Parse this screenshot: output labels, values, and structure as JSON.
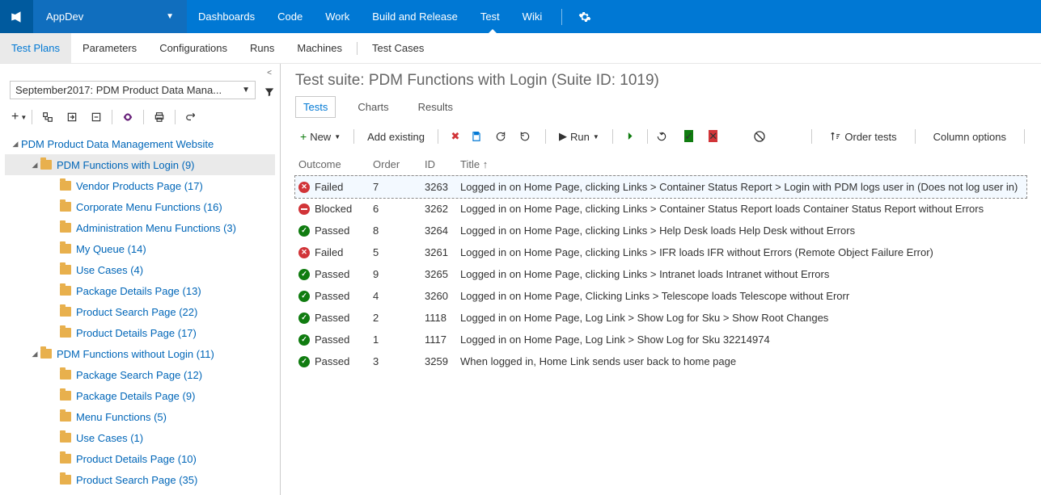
{
  "topnav": {
    "project": "AppDev",
    "tabs": [
      "Dashboards",
      "Code",
      "Work",
      "Build and Release",
      "Test",
      "Wiki"
    ],
    "active_tab": 4
  },
  "subnav": {
    "tabs": [
      "Test Plans",
      "Parameters",
      "Configurations",
      "Runs",
      "Machines"
    ],
    "extra": [
      "Test Cases"
    ],
    "active": 0
  },
  "plan_dropdown": "September2017: PDM Product Data Mana...",
  "tree": [
    {
      "depth": 1,
      "exp": "▲",
      "label": "PDM Product Data Management Website"
    },
    {
      "depth": 2,
      "exp": "▲",
      "label": "PDM Functions with Login (9)",
      "selected": true
    },
    {
      "depth": 3,
      "exp": "",
      "label": "Vendor Products Page (17)"
    },
    {
      "depth": 3,
      "exp": "",
      "label": "Corporate Menu Functions (16)"
    },
    {
      "depth": 3,
      "exp": "",
      "label": "Administration Menu Functions (3)"
    },
    {
      "depth": 3,
      "exp": "",
      "label": "My Queue (14)"
    },
    {
      "depth": 3,
      "exp": "",
      "label": "Use Cases (4)"
    },
    {
      "depth": 3,
      "exp": "",
      "label": "Package Details Page (13)"
    },
    {
      "depth": 3,
      "exp": "",
      "label": "Product Search Page (22)"
    },
    {
      "depth": 3,
      "exp": "",
      "label": "Product Details Page (17)"
    },
    {
      "depth": 2,
      "exp": "▲",
      "label": "PDM Functions without Login (11)"
    },
    {
      "depth": 3,
      "exp": "",
      "label": "Package Search Page (12)"
    },
    {
      "depth": 3,
      "exp": "",
      "label": "Package Details Page (9)"
    },
    {
      "depth": 3,
      "exp": "",
      "label": "Menu Functions (5)"
    },
    {
      "depth": 3,
      "exp": "",
      "label": "Use Cases (1)"
    },
    {
      "depth": 3,
      "exp": "",
      "label": "Product Details Page (10)"
    },
    {
      "depth": 3,
      "exp": "",
      "label": "Product Search Page (35)"
    }
  ],
  "suite_title": "Test suite: PDM Functions with Login (Suite ID: 1019)",
  "tabs2": {
    "items": [
      "Tests",
      "Charts",
      "Results"
    ],
    "active": 0
  },
  "toolbar": {
    "new": "New",
    "add_existing": "Add existing",
    "run": "Run",
    "order_tests": "Order tests",
    "column_options": "Column options"
  },
  "columns": {
    "outcome": "Outcome",
    "order": "Order",
    "id": "ID",
    "title": "Title"
  },
  "rows": [
    {
      "outcome": "Failed",
      "icon": "fail",
      "order": "7",
      "id": "3263",
      "title": "Logged in on Home Page, clicking Links > Container Status Report > Login with PDM logs user in (Does not log user in)",
      "active": true
    },
    {
      "outcome": "Blocked",
      "icon": "block",
      "order": "6",
      "id": "3262",
      "title": "Logged in on Home Page, clicking Links > Container Status Report loads Container Status Report without Errors"
    },
    {
      "outcome": "Passed",
      "icon": "pass",
      "order": "8",
      "id": "3264",
      "title": "Logged in on Home Page, clicking Links > Help Desk loads Help Desk without Errors"
    },
    {
      "outcome": "Failed",
      "icon": "fail",
      "order": "5",
      "id": "3261",
      "title": "Logged in on Home Page, clicking Links > IFR loads IFR without Errors (Remote Object Failure Error)"
    },
    {
      "outcome": "Passed",
      "icon": "pass",
      "order": "9",
      "id": "3265",
      "title": "Logged in on Home Page, clicking Links > Intranet loads Intranet without Errors"
    },
    {
      "outcome": "Passed",
      "icon": "pass",
      "order": "4",
      "id": "3260",
      "title": "Logged in on Home Page, Clicking Links > Telescope loads Telescope without Erorr"
    },
    {
      "outcome": "Passed",
      "icon": "pass",
      "order": "2",
      "id": "1118",
      "title": "Logged in on Home Page, Log Link > Show Log for Sku > Show Root Changes"
    },
    {
      "outcome": "Passed",
      "icon": "pass",
      "order": "1",
      "id": "1117",
      "title": "Logged in on Home Page, Log Link > Show Log for Sku 32214974"
    },
    {
      "outcome": "Passed",
      "icon": "pass",
      "order": "3",
      "id": "3259",
      "title": "When logged in, Home Link sends user back to home page"
    }
  ]
}
